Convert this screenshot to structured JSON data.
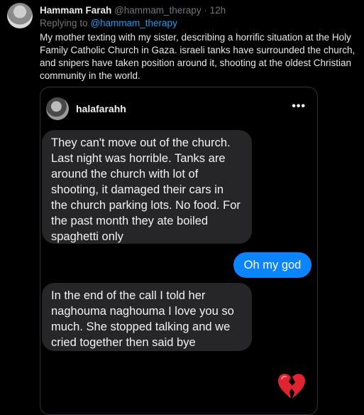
{
  "tweet": {
    "author_name": "Hammam Farah",
    "handle": "@hammam_therapy",
    "separator": "·",
    "time": "12h",
    "replying_to_label": "Replying to",
    "replying_to_handle": "@hammam_therapy",
    "text": "My mother texting with my sister, describing a horrific situation at the Holy Family Catholic Church in Gaza. israeli tanks have surrounded the church, and snipers have taken position around it, shooting at the oldest Christian community in the world."
  },
  "media": {
    "thread_username": "halafarahh",
    "more_icon": "•••",
    "messages": [
      {
        "direction": "in",
        "text": "They can't move out of the church. Last night was horrible. Tanks are around the church with lot of shooting, it damaged their cars in the church parking lots. No food. For the past month they ate boiled spaghetti only"
      },
      {
        "direction": "out",
        "text": "Oh my god"
      },
      {
        "direction": "in",
        "text": "In the end of the call I told her naghouma naghouma I love you so much. She stopped talking and we cried together then said bye"
      }
    ],
    "reaction_emoji_icon": "broken-heart-icon"
  },
  "colors": {
    "background": "#000000",
    "link": "#1d9bf0",
    "incoming_bubble": "#262628",
    "outgoing_bubble": "#0a84ff",
    "heart": "#e0242f"
  }
}
